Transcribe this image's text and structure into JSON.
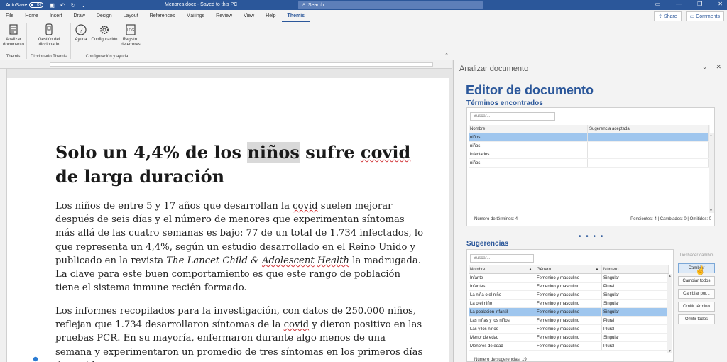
{
  "titlebar": {
    "autosave_label": "AutoSave",
    "autosave_state": "Off",
    "doc_name": "Menores.docx  -  Saved to this PC",
    "search_placeholder": "Search"
  },
  "tabs": [
    "File",
    "Home",
    "Insert",
    "Draw",
    "Design",
    "Layout",
    "References",
    "Mailings",
    "Review",
    "View",
    "Help",
    "Themis"
  ],
  "active_tab": "Themis",
  "share_label": "Share",
  "comments_label": "Comments",
  "ribbon": {
    "groups": [
      {
        "label": "Themis",
        "buttons": [
          {
            "line1": "Analizar",
            "line2": "documento",
            "icon": "analyze-document-icon"
          }
        ]
      },
      {
        "label": "Diccionario Themis",
        "buttons": [
          {
            "line1": "Gestión del",
            "line2": "diccionario",
            "icon": "dictionary-icon"
          }
        ]
      },
      {
        "label": "Configuración y ayuda",
        "buttons": [
          {
            "line1": "Ayuda",
            "line2": "",
            "icon": "help-icon"
          },
          {
            "line1": "Configuración",
            "line2": "",
            "icon": "gear-icon"
          },
          {
            "line1": "Registro",
            "line2": "de errores",
            "icon": "log-icon"
          }
        ]
      }
    ]
  },
  "document": {
    "headline_part1": "Solo un 4,4% de los ",
    "headline_highlight": "niños",
    "headline_part2": " sufre ",
    "headline_squig": "covid",
    "headline_part3": " de larga duración",
    "p1_a": "Los niños de entre 5 y 17 años que desarrollan la ",
    "p1_squig1": "covid",
    "p1_b": " suelen mejorar después de seis días y el número de menores que experimentan síntomas más allá de las cuatro semanas es bajo: 77 de un total de 1.734 infectados, lo que representa un 4,4%, según un estudio desarrollado en el Reino Unido y publicado en la revista ",
    "p1_italic": "The Lancet Child & ",
    "p1_italic_squig1": "Adolescent",
    "p1_italic_space": " ",
    "p1_italic_squig2": "Health",
    "p1_c": " la madrugada. La clave para este buen comportamiento es que este rango de población tiene el sistema inmune recién formado.",
    "p2_a": "Los informes recopilados para la investigación, con datos de 250.000 niños, reflejan que 1.734 desarrollaron síntomas de la ",
    "p2_squig1": "covid",
    "p2_b": " y dieron positivo en las pruebas PCR. En su mayoría, enfermaron durante algo menos de una semana y experimentaron un promedio de tres síntomas en los primeros días de ",
    "p2_squig2": "covid",
    "p2_c": "."
  },
  "panel": {
    "title": "Analizar documento",
    "editor_title": "Editor de documento",
    "terms": {
      "section_title": "Términos encontrados",
      "search_placeholder": "Buscar...",
      "col_name": "Nombre",
      "col_suggestion": "Sugerencia aceptada",
      "rows": [
        {
          "name": "niños",
          "suggestion": ""
        },
        {
          "name": "niños",
          "suggestion": ""
        },
        {
          "name": "infectados",
          "suggestion": ""
        },
        {
          "name": "niños",
          "suggestion": ""
        }
      ],
      "count_label": "Número de términos: 4",
      "status_label": "Pendientes: 4  |  Cambiados: 0  |  Omitidos: 0"
    },
    "suggestions": {
      "section_title": "Sugerencias",
      "search_placeholder": "Buscar...",
      "col_name": "Nombre",
      "col_gender": "Género",
      "col_number": "Número",
      "rows": [
        {
          "name": "Infante",
          "gender": "Femenino y masculino",
          "number": "Singular"
        },
        {
          "name": "Infantes",
          "gender": "Femenino y masculino",
          "number": "Plural"
        },
        {
          "name": "La niña o el niño",
          "gender": "Femenino y masculino",
          "number": "Singular"
        },
        {
          "name": "La o el niño",
          "gender": "Femenino y masculino",
          "number": "Singular"
        },
        {
          "name": "La población infantil",
          "gender": "Femenino y masculino",
          "number": "Singular"
        },
        {
          "name": "Las niñas y los niños",
          "gender": "Femenino y masculino",
          "number": "Plural"
        },
        {
          "name": "Las y los niños",
          "gender": "Femenino y masculino",
          "number": "Plural"
        },
        {
          "name": "Menor de edad",
          "gender": "Femenino y masculino",
          "number": "Singular"
        },
        {
          "name": "Menores de edad",
          "gender": "Femenino y masculino",
          "number": "Plural"
        }
      ],
      "count_label": "Número de sugerencias: 19"
    },
    "buttons": {
      "undo": "Deshacer cambio",
      "change": "Cambiar",
      "change_all": "Cambiar todos",
      "change_for": "Cambiar por...",
      "skip_term": "Omitir término",
      "skip_all": "Omitir todos"
    }
  },
  "colors": {
    "accent": "#2b579a",
    "selection": "#9fc6ee"
  }
}
